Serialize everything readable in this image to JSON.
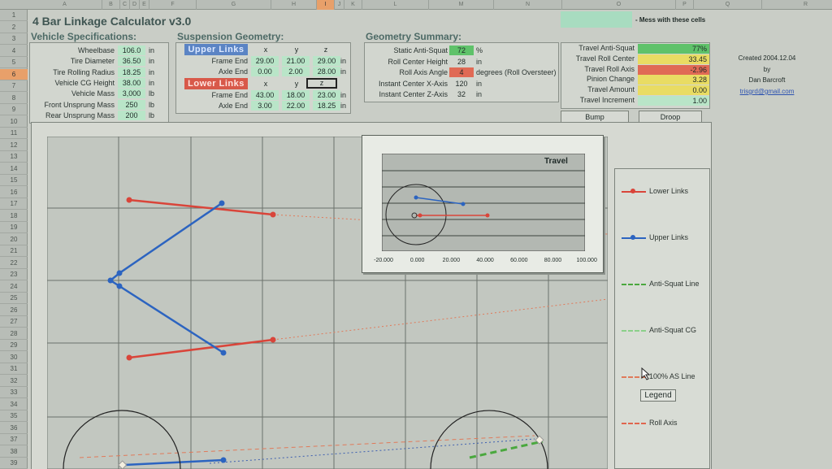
{
  "header": {
    "mess_note": "- Mess with these cells"
  },
  "columns": [
    "A",
    "B",
    "C",
    "D",
    "E",
    "F",
    "G",
    "H",
    "I",
    "J",
    "K",
    "L",
    "M",
    "N",
    "O",
    "P",
    "Q",
    "R"
  ],
  "rows": [
    "1",
    "2",
    "3",
    "4",
    "5",
    "6",
    "7",
    "8",
    "9",
    "10",
    "11",
    "12",
    "13",
    "14",
    "15",
    "16",
    "17",
    "18",
    "19",
    "20",
    "21",
    "22",
    "23",
    "24",
    "25",
    "26",
    "27",
    "28",
    "29",
    "30",
    "31",
    "32",
    "33",
    "34",
    "35",
    "36",
    "37",
    "38",
    "39"
  ],
  "title": "4 Bar Linkage Calculator v3.0",
  "vehicle": {
    "heading": "Vehicle Specifications:",
    "items": [
      {
        "label": "Wheelbase",
        "value": "106.0",
        "unit": "in"
      },
      {
        "label": "Tire Diameter",
        "value": "36.50",
        "unit": "in"
      },
      {
        "label": "Tire Rolling Radius",
        "value": "18.25",
        "unit": "in"
      },
      {
        "label": "Vehicle CG Height",
        "value": "38.00",
        "unit": "in"
      },
      {
        "label": "Vehicle Mass",
        "value": "3,000",
        "unit": "lb"
      },
      {
        "label": "Front Unsprung Mass",
        "value": "250",
        "unit": "lb"
      },
      {
        "label": "Rear Unsprung Mass",
        "value": "200",
        "unit": "lb"
      }
    ]
  },
  "suspension": {
    "heading": "Suspension Geometry:",
    "upper_label": "Upper Links",
    "lower_label": "Lower Links",
    "x": "x",
    "y": "y",
    "z": "z",
    "unit": "in",
    "upper": [
      {
        "label": "Frame End",
        "x": "29.00",
        "y": "21.00",
        "z": "29.00"
      },
      {
        "label": "Axle End",
        "x": "0.00",
        "y": "2.00",
        "z": "28.00"
      }
    ],
    "lower": [
      {
        "label": "Frame End",
        "x": "43.00",
        "y": "18.00",
        "z": "23.00"
      },
      {
        "label": "Axle End",
        "x": "3.00",
        "y": "22.00",
        "z": "18.25"
      }
    ]
  },
  "summary": {
    "heading": "Geometry Summary:",
    "items": [
      {
        "label": "Static Anti-Squat",
        "value": "72",
        "unit": "%"
      },
      {
        "label": "Roll Center Height",
        "value": "28",
        "unit": "in"
      },
      {
        "label": "Roll Axis Angle",
        "value": "4",
        "unit": "degrees (Roll Oversteer)"
      },
      {
        "label": "Instant Center X-Axis",
        "value": "120",
        "unit": "in"
      },
      {
        "label": "Instant Center Z-Axis",
        "value": "32",
        "unit": "in"
      }
    ]
  },
  "travel": {
    "items": [
      {
        "label": "Travel Anti-Squat",
        "value": "77%",
        "color": "#5fc26a"
      },
      {
        "label": "Travel Roll Center",
        "value": "33.45",
        "color": "#e9dc63"
      },
      {
        "label": "Travel Roll Axis",
        "value": "-2.96",
        "color": "#e06a55"
      },
      {
        "label": "Pinion Change",
        "value": "3.28",
        "color": "#e9dc63"
      },
      {
        "label": "Travel Amount",
        "value": "0.00",
        "color": "#e9dc63"
      },
      {
        "label": "Travel Increment",
        "value": "1.00",
        "color": "#b9e5c8"
      }
    ],
    "bump": "Bump",
    "droop": "Droop"
  },
  "credit": {
    "created": "Created 2004.12.04",
    "by": "by",
    "author": "Dan Barcroft",
    "email": "trisgrd@gmail.com"
  },
  "travel_chart": {
    "title": "Travel",
    "ticks": [
      "-20.000",
      "0.000",
      "20.000",
      "40.000",
      "60.000",
      "80.000",
      "100.000"
    ]
  },
  "legend": {
    "items": [
      {
        "label": "Lower Links",
        "color": "#d9453a"
      },
      {
        "label": "Upper Links",
        "color": "#2c64c0"
      },
      {
        "label": "Anti-Squat Line",
        "color": "#4aa83e"
      },
      {
        "label": "Anti-Squat CG",
        "color": "#8bd08a"
      },
      {
        "label": "100% AS Line",
        "color": "#e07a5a"
      },
      {
        "label": "Roll Axis",
        "color": "#e0664e"
      }
    ],
    "button": "Legend"
  },
  "colors": {
    "accent_blue": "#2c64c0",
    "accent_red": "#d9453a",
    "cell_green": "#b9e5c8"
  }
}
